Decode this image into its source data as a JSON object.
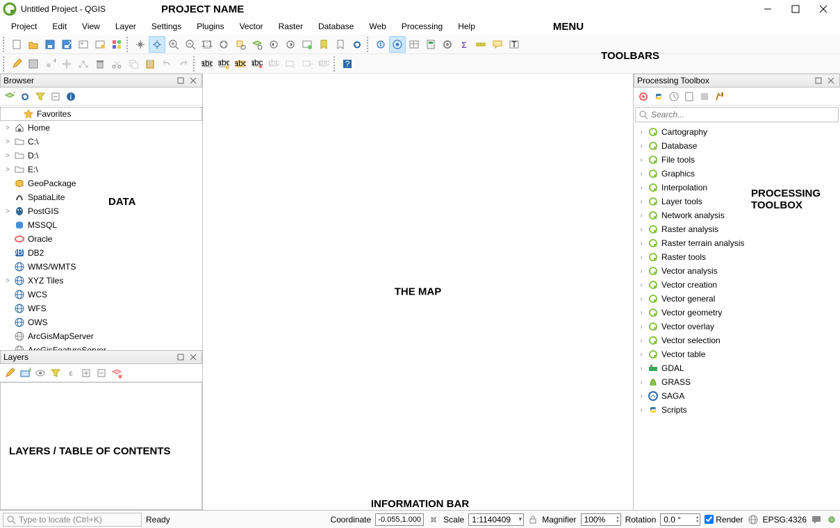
{
  "window": {
    "title": "Untitled Project - QGIS"
  },
  "annotations": {
    "project_name": "PROJECT NAME",
    "menu": "MENU",
    "toolbars": "TOOLBARS",
    "data": "DATA",
    "layers": "LAYERS / TABLE OF CONTENTS",
    "map": "THE MAP",
    "processing": "PROCESSING TOOLBOX",
    "info": "INFORMATION BAR"
  },
  "menu": [
    "Project",
    "Edit",
    "View",
    "Layer",
    "Settings",
    "Plugins",
    "Vector",
    "Raster",
    "Database",
    "Web",
    "Processing",
    "Help"
  ],
  "panels": {
    "browser": {
      "title": "Browser"
    },
    "layers": {
      "title": "Layers"
    },
    "processing": {
      "title": "Processing Toolbox",
      "search_placeholder": "Search..."
    }
  },
  "browser_items": [
    {
      "label": "Favorites",
      "icon": "star",
      "exp": "",
      "sel": true
    },
    {
      "label": "Home",
      "icon": "home",
      "exp": ">"
    },
    {
      "label": "C:\\",
      "icon": "folder",
      "exp": ">"
    },
    {
      "label": "D:\\",
      "icon": "folder",
      "exp": ">"
    },
    {
      "label": "E:\\",
      "icon": "folder",
      "exp": ">"
    },
    {
      "label": "GeoPackage",
      "icon": "geopackage",
      "exp": ""
    },
    {
      "label": "SpatiaLite",
      "icon": "spatialite",
      "exp": ""
    },
    {
      "label": "PostGIS",
      "icon": "postgis",
      "exp": ">"
    },
    {
      "label": "MSSQL",
      "icon": "mssql",
      "exp": ""
    },
    {
      "label": "Oracle",
      "icon": "oracle",
      "exp": ""
    },
    {
      "label": "DB2",
      "icon": "db2",
      "exp": ""
    },
    {
      "label": "WMS/WMTS",
      "icon": "globe",
      "exp": ""
    },
    {
      "label": "XYZ Tiles",
      "icon": "globe",
      "exp": ">"
    },
    {
      "label": "WCS",
      "icon": "globe",
      "exp": ""
    },
    {
      "label": "WFS",
      "icon": "globe",
      "exp": ""
    },
    {
      "label": "OWS",
      "icon": "globe",
      "exp": ""
    },
    {
      "label": "ArcGisMapServer",
      "icon": "globe-grey",
      "exp": ""
    },
    {
      "label": "ArcGisFeatureServer",
      "icon": "globe-grey",
      "exp": ""
    }
  ],
  "processing_items": [
    {
      "label": "Cartography",
      "icon": "q"
    },
    {
      "label": "Database",
      "icon": "q"
    },
    {
      "label": "File tools",
      "icon": "q"
    },
    {
      "label": "Graphics",
      "icon": "q"
    },
    {
      "label": "Interpolation",
      "icon": "q"
    },
    {
      "label": "Layer tools",
      "icon": "q"
    },
    {
      "label": "Network analysis",
      "icon": "q"
    },
    {
      "label": "Raster analysis",
      "icon": "q"
    },
    {
      "label": "Raster terrain analysis",
      "icon": "q"
    },
    {
      "label": "Raster tools",
      "icon": "q"
    },
    {
      "label": "Vector analysis",
      "icon": "q"
    },
    {
      "label": "Vector creation",
      "icon": "q"
    },
    {
      "label": "Vector general",
      "icon": "q"
    },
    {
      "label": "Vector geometry",
      "icon": "q"
    },
    {
      "label": "Vector overlay",
      "icon": "q"
    },
    {
      "label": "Vector selection",
      "icon": "q"
    },
    {
      "label": "Vector table",
      "icon": "q"
    },
    {
      "label": "GDAL",
      "icon": "gdal"
    },
    {
      "label": "GRASS",
      "icon": "grass"
    },
    {
      "label": "SAGA",
      "icon": "saga"
    },
    {
      "label": "Scripts",
      "icon": "python"
    }
  ],
  "status": {
    "locator_placeholder": "Type to locate (Ctrl+K)",
    "ready": "Ready",
    "coordinate_label": "Coordinate",
    "coordinate": "-0.055,1.000",
    "scale_label": "Scale",
    "scale": "1:1140409",
    "magnifier_label": "Magnifier",
    "magnifier": "100%",
    "rotation_label": "Rotation",
    "rotation": "0.0 °",
    "render": "Render",
    "crs": "EPSG:4326"
  }
}
